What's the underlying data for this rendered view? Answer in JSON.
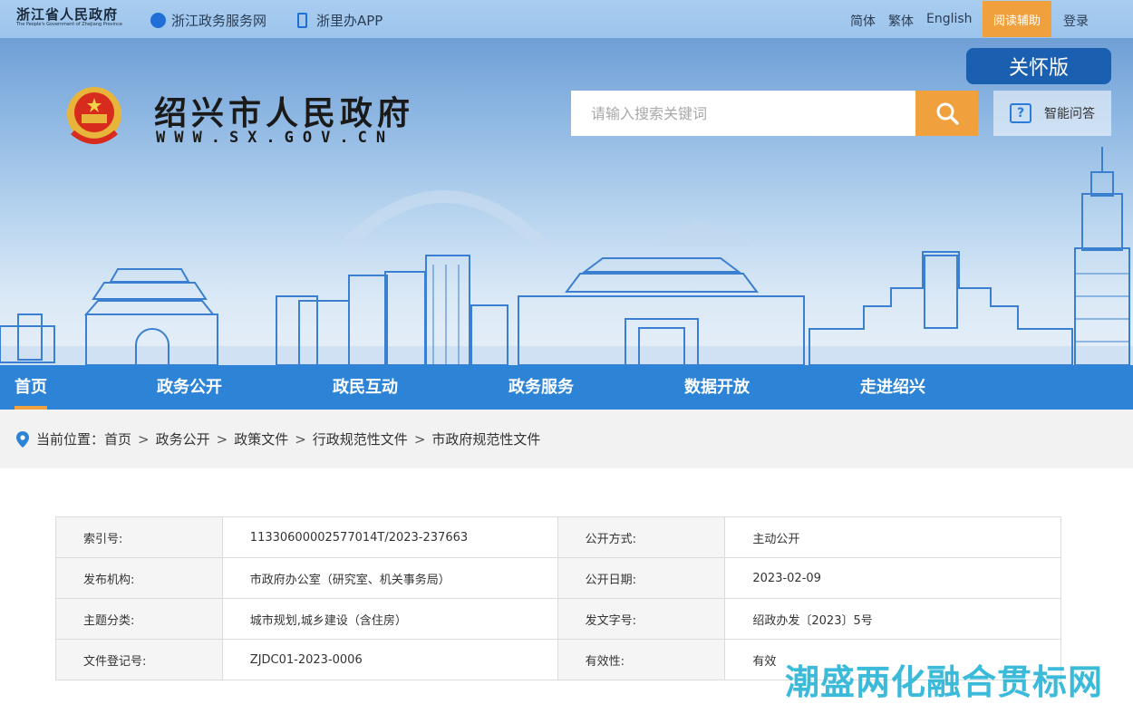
{
  "topbar": {
    "province_logo_cn": "浙江省人民政府",
    "province_logo_en": "The People's Government of Zhejiang Province",
    "links": [
      {
        "label": "浙江政务服务网"
      },
      {
        "label": "浙里办APP"
      }
    ],
    "lang_simplified": "简体",
    "lang_traditional": "繁体",
    "lang_english": "English",
    "reading_assist": "阅读辅助",
    "login": "登录"
  },
  "banner": {
    "site_name": "绍兴市人民政府",
    "site_url": "WWW.SX.GOV.CN",
    "care_version": "关怀版",
    "search_placeholder": "请输入搜索关键词",
    "smart_qa": "智能问答"
  },
  "nav": {
    "items": [
      {
        "label": "首页"
      },
      {
        "label": "政务公开"
      },
      {
        "label": "政民互动"
      },
      {
        "label": "政务服务"
      },
      {
        "label": "数据开放"
      },
      {
        "label": "走进绍兴"
      }
    ]
  },
  "breadcrumb": {
    "prefix": "当前位置：",
    "items": [
      {
        "label": "首页"
      },
      {
        "label": "政务公开"
      },
      {
        "label": "政策文件"
      },
      {
        "label": "行政规范性文件"
      },
      {
        "label": "市政府规范性文件"
      }
    ]
  },
  "info": {
    "rows": [
      {
        "k1": "索引号:",
        "v1": "11330600002577014T/2023-237663",
        "k2": "公开方式:",
        "v2": "主动公开"
      },
      {
        "k1": "发布机构:",
        "v1": "市政府办公室（研究室、机关事务局）",
        "k2": "公开日期:",
        "v2": "2023-02-09"
      },
      {
        "k1": "主题分类:",
        "v1": "城市规划,城乡建设（含住房）",
        "k2": "发文字号:",
        "v2": "绍政办发〔2023〕5号"
      },
      {
        "k1": "文件登记号:",
        "v1": "ZJDC01-2023-0006",
        "k2": "有效性:",
        "v2": "有效"
      }
    ]
  },
  "watermark": "潮盛两化融合贯标网",
  "colors": {
    "nav_blue": "#2d84d6",
    "accent_orange": "#f0a03d",
    "care_blue": "#1b5fb0"
  }
}
